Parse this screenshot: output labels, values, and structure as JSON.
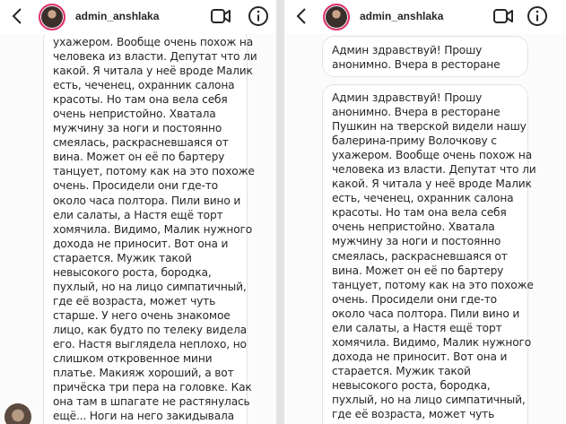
{
  "left": {
    "header": {
      "username": "admin_anshlaka"
    },
    "message": "ухажером. Вообще очень похож на\nчеловека из власти. Депутат что ли\nкакой. Я читала у неё вроде Малик\nесть, чеченец, охранник салона\nкрасоты. Но там она вела себя\nочень непристойно. Хватала\nмужчину за ноги и постоянно\nсмеялась, раскрасневшаяся от\nвина. Может он её по бартеру\nтанцует, потому как на это похоже\nочень. Просидели они где-то\nоколо часа полтора. Пили вино и\nели салаты, а Настя ещё торт\nхомячила. Видимо, Малик нужного\nдохода не приносит. Вот она и\nстарается. Мужик такой\nневысокого роста, бородка,\nпухлый, но на лицо симпатичный,\nгде её возраста, может чуть\nстарше. У него очень знакомое\nлицо, как будто по телеку видела\nего. Настя выглядела неплохо, но\nслишком откровенное мини\nплатье. Макияж хороший, а вот\nпричёска три пера на головке. Как\nона там в шпагате не растянулась\nещё... Ноги на него закидывала"
  },
  "right": {
    "header": {
      "username": "admin_anshlaka"
    },
    "reply_preview": "Админ здравствуй! Прошу\nанонимно. Вчера в ресторане",
    "message": "Админ здравствуй! Прошу\nанонимно. Вчера в ресторане\nПушкин на тверской видели нашу\nбалерина-приму Волочкову с\nухажером. Вообще очень похож на\nчеловека из власти. Депутат что ли\nкакой. Я читала у неё вроде Малик\nесть, чеченец, охранник салона\nкрасоты. Но там она вела себя\nочень непристойно. Хватала\nмужчину за ноги и постоянно\nсмеялась, раскрасневшаяся от\nвина. Может он её по бартеру\nтанцует, потому как на это похоже\nочень. Просидели они где-то\nоколо часа полтора. Пили вино и\nели салаты, а Настя ещё торт\nхомячила. Видимо, Малик нужного\nдохода не приносит. Вот она и\nстарается. Мужик такой\nневысокого роста, бородка,\nпухлый, но на лицо симпатичный,\nгде её возраста, может чуть"
  },
  "icons": {
    "back": "chevron-left-icon",
    "video": "video-camera-icon",
    "info": "info-icon"
  }
}
